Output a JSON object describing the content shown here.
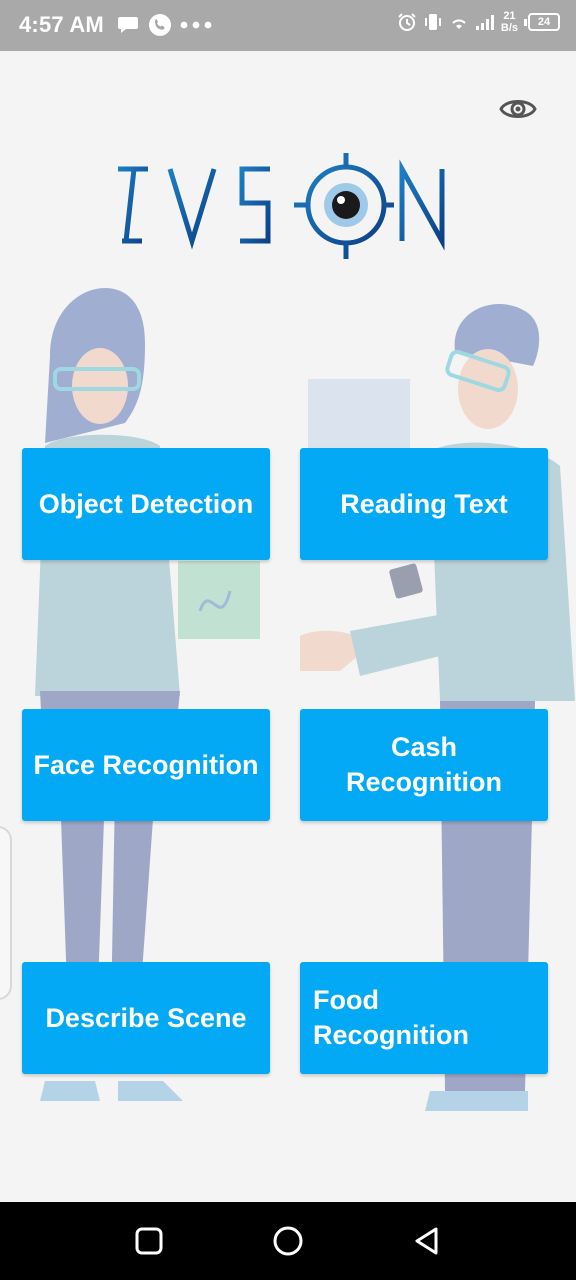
{
  "status_bar": {
    "time": "4:57 AM",
    "net_speed_value": "21",
    "net_speed_unit": "B/s",
    "battery_level": "24"
  },
  "app": {
    "logo_text": "I-VISION",
    "colors": {
      "primary_button": "#03a9f4",
      "logo_blue": "#1a8fd0"
    },
    "menu": {
      "object_detection": "Object Detection",
      "reading_text": "Reading Text",
      "face_recognition": "Face Recognition",
      "cash_recognition": "Cash Recognition",
      "describe_scene": "Describe Scene",
      "food_recognition": "Food Recognition"
    }
  },
  "icons": [
    "chat-icon",
    "phone-icon",
    "more-dots-icon",
    "alarm-icon",
    "vibrate-icon",
    "wifi-icon",
    "signal-icon",
    "battery-icon",
    "eye-icon",
    "recent-apps-icon",
    "home-icon",
    "back-icon"
  ]
}
